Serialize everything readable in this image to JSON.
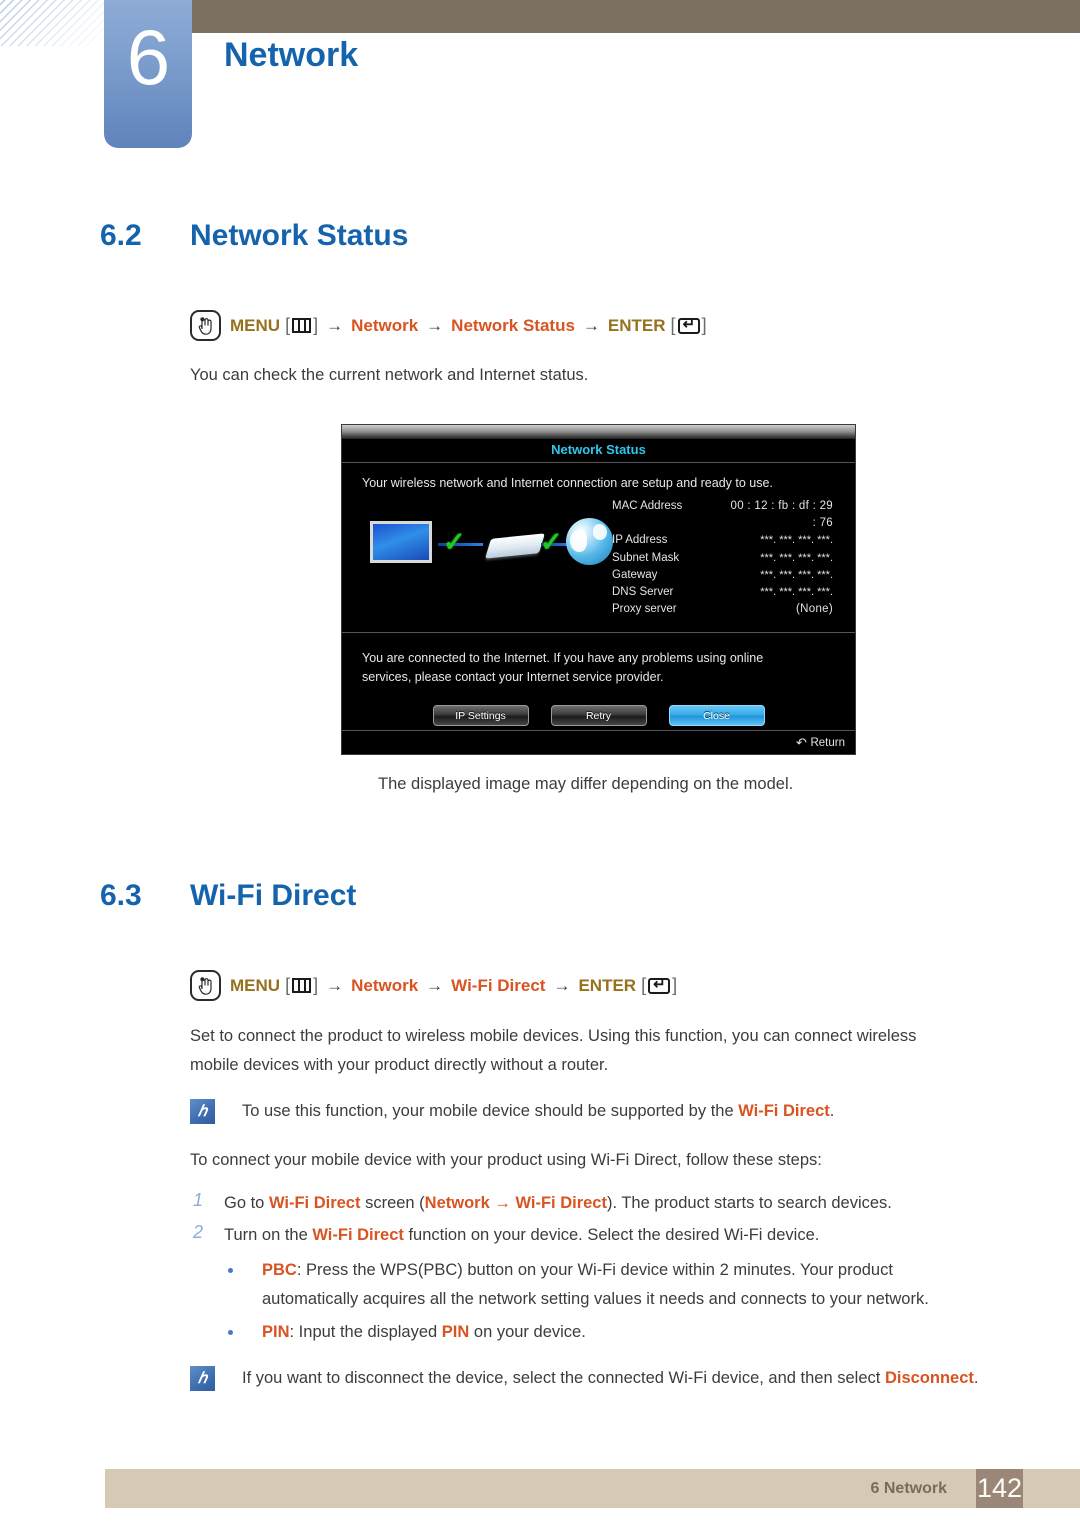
{
  "header": {
    "chapter_number": "6",
    "chapter_title": "Network"
  },
  "sections": [
    {
      "number": "6.2",
      "title": "Network Status",
      "menu_path": {
        "menu_label": "MENU",
        "arrow": "→",
        "step1": "Network",
        "step2": "Network Status",
        "enter_label": "ENTER"
      },
      "intro": "You can check the current network and Internet status.",
      "caption": "The displayed image may differ depending on the model."
    },
    {
      "number": "6.3",
      "title": "Wi-Fi Direct",
      "menu_path": {
        "menu_label": "MENU",
        "arrow": "→",
        "step1": "Network",
        "step2": "Wi-Fi Direct",
        "enter_label": "ENTER"
      },
      "para1_a": "Set to connect the product to wireless mobile devices. Using this function, you can connect wireless",
      "para1_b": "mobile devices with your product directly without a router.",
      "note1_pre": "To use this function, your mobile device should be supported by the ",
      "note1_em": "Wi-Fi Direct",
      "note1_post": ".",
      "para2": "To connect your mobile device with your product using Wi-Fi Direct, follow these steps:",
      "steps": [
        {
          "num": "1",
          "pre": "Go to ",
          "em1": "Wi-Fi Direct",
          "mid1": " screen (",
          "em2": "Network",
          "arrow": " → ",
          "em3": "Wi-Fi Direct",
          "post": "). The product starts to search devices."
        },
        {
          "num": "2",
          "pre": "Turn on the ",
          "em1": "Wi-Fi Direct",
          "post": " function on your device. Select the desired Wi-Fi device."
        }
      ],
      "bullets": [
        {
          "em": "PBC",
          "line1": ": Press the WPS(PBC) button on your Wi-Fi device within 2 minutes. Your product",
          "line2": "automatically acquires all the network setting values it needs and connects to your network."
        },
        {
          "em": "PIN",
          "line1_pre": ": Input the displayed ",
          "line1_em": "PIN",
          "line1_post": " on your device."
        }
      ],
      "note2_pre": "If you want to disconnect the device, select the connected Wi-Fi device, and then select ",
      "note2_em": "Disconnect",
      "note2_post": "."
    }
  ],
  "tv_screenshot": {
    "title": "Network Status",
    "subtitle": "Your wireless network and Internet connection are setup and ready to use.",
    "rows": [
      {
        "label": "MAC Address",
        "value": "00 : 12 : fb : df : 29 : 76"
      },
      {
        "label": "IP Address",
        "value": "***.   ***.   ***.   ***."
      },
      {
        "label": "Subnet Mask",
        "value": "***.   ***.   ***.   ***."
      },
      {
        "label": "Gateway",
        "value": "***.   ***.   ***.   ***."
      },
      {
        "label": "DNS Server",
        "value": "***.   ***.   ***.   ***."
      },
      {
        "label": "Proxy server",
        "value": "(None)"
      }
    ],
    "message_line1": "You are connected to the Internet. If you have any problems using online",
    "message_line2": "services, please contact your Internet service provider.",
    "buttons": [
      {
        "label": "IP Settings",
        "selected": false
      },
      {
        "label": "Retry",
        "selected": false
      },
      {
        "label": "Close",
        "selected": true
      }
    ],
    "return_label": "Return"
  },
  "footer": {
    "chapter_label": "6 Network",
    "page_number": "142"
  },
  "colors": {
    "heading_blue": "#1463ac",
    "accent_orange": "#d85421",
    "menu_gold": "#96721f",
    "topbar_brown": "#7c7062",
    "footer_tan": "#d7cab5",
    "footer_page_brown": "#9b8778",
    "tv_title_cyan": "#2fc6ee"
  }
}
